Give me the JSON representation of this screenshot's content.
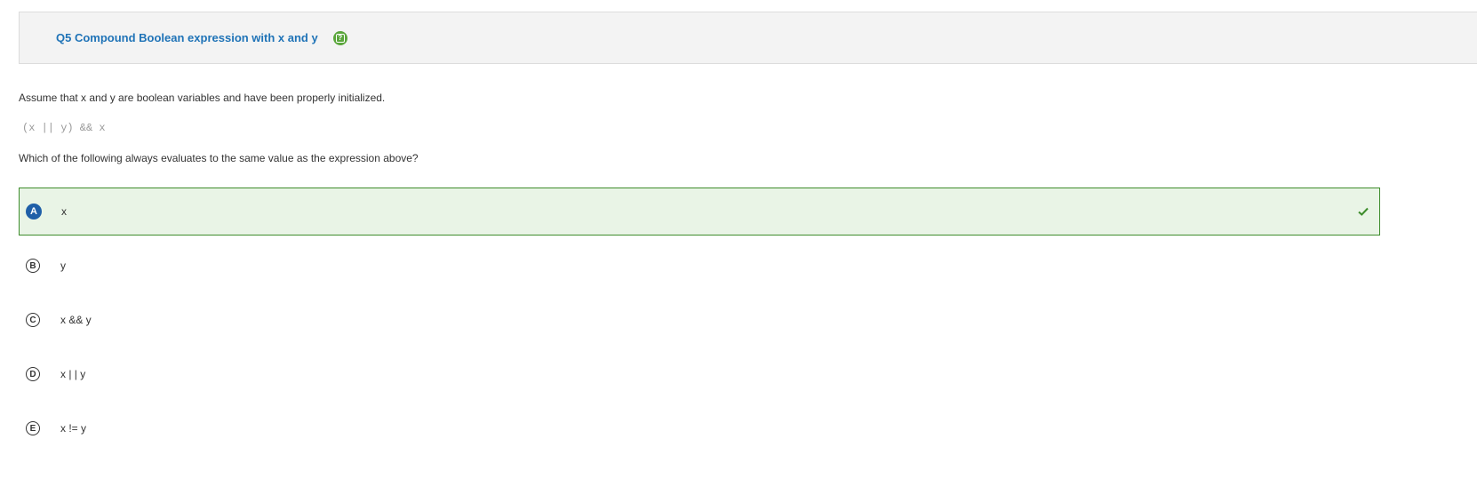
{
  "header": {
    "title": "Q5 Compound Boolean expression with x and y",
    "help_icon": "help-icon",
    "help_color": "#5aa63b"
  },
  "prompt": "Assume that x and y are boolean variables and have been properly initialized.",
  "code": "(x || y) && x",
  "question": "Which of the following always evaluates to the same value as the expression above?",
  "choices": [
    {
      "letter": "A",
      "text": "x",
      "selected": true,
      "correct": true
    },
    {
      "letter": "B",
      "text": "y",
      "selected": false,
      "correct": false
    },
    {
      "letter": "C",
      "text": "x && y",
      "selected": false,
      "correct": false
    },
    {
      "letter": "D",
      "text": "x | | y",
      "selected": false,
      "correct": false
    },
    {
      "letter": "E",
      "text": "x != y",
      "selected": false,
      "correct": false
    }
  ],
  "colors": {
    "title": "#1f73b7",
    "correct_bg": "#e9f4e6",
    "correct_border": "#3d8c2b",
    "selected_bubble": "#1f5fa8",
    "check": "#3d8c2b"
  },
  "icons": {
    "correct_marker": "check-icon"
  }
}
